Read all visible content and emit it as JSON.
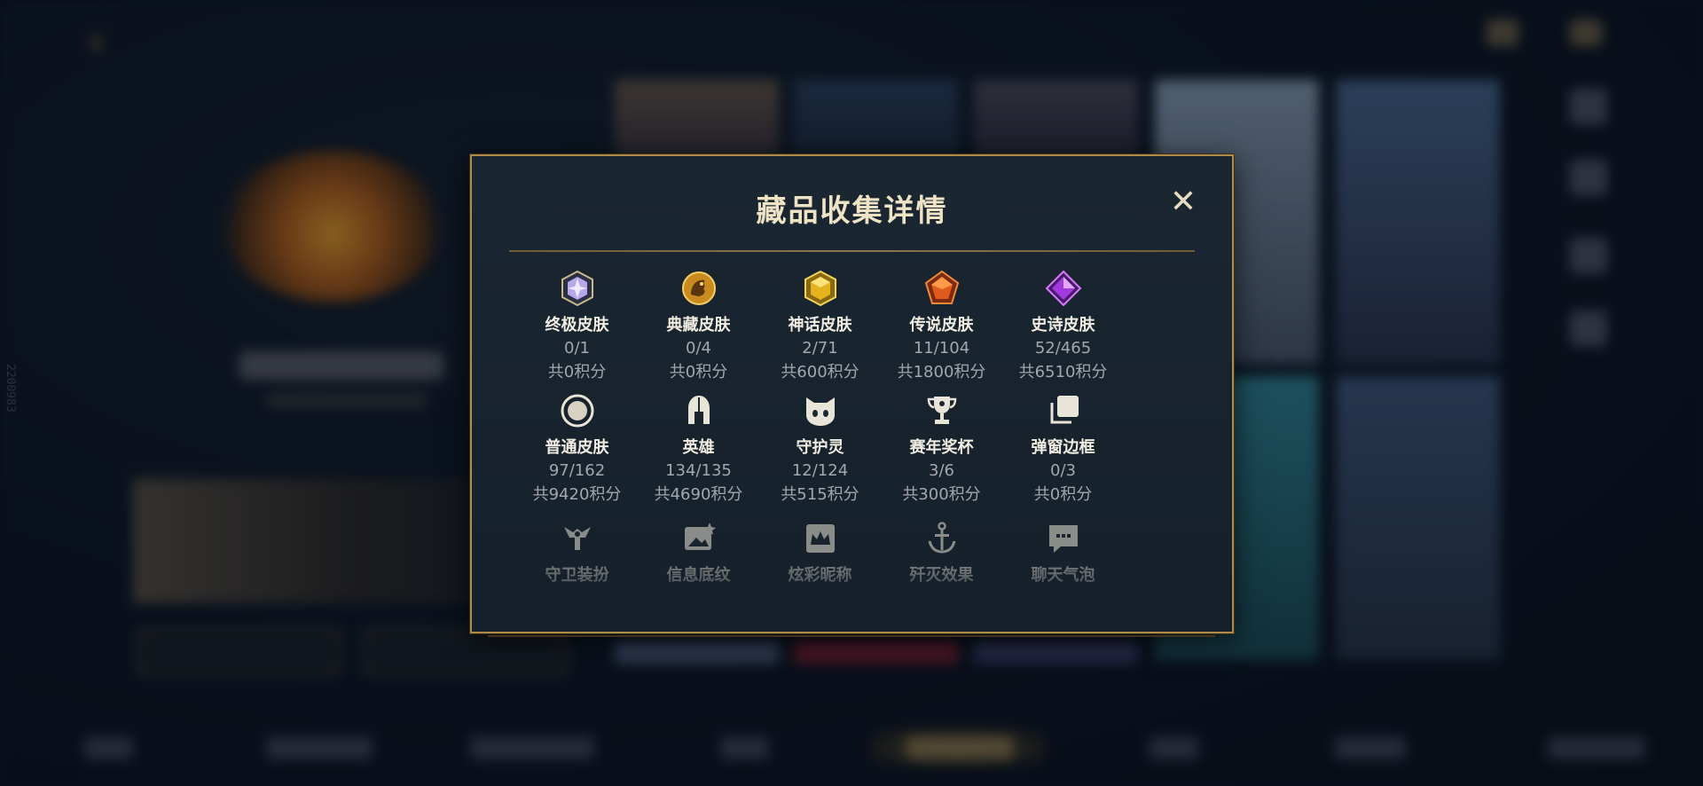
{
  "colors": {
    "accent_gold": "#b08a47",
    "modal_bg": "#16212b",
    "title_text": "#efe3c6"
  },
  "side_id": "2200983",
  "modal": {
    "title": "藏品收集详情",
    "close_icon": "close-icon",
    "rows": [
      [
        {
          "icon": "ultimate-skin-icon",
          "label": "终极皮肤",
          "count": "0/1",
          "points": "共0积分"
        },
        {
          "icon": "collection-skin-icon",
          "label": "典藏皮肤",
          "count": "0/4",
          "points": "共0积分"
        },
        {
          "icon": "myth-skin-icon",
          "label": "神话皮肤",
          "count": "2/71",
          "points": "共600积分"
        },
        {
          "icon": "legend-skin-icon",
          "label": "传说皮肤",
          "count": "11/104",
          "points": "共1800积分"
        },
        {
          "icon": "epic-skin-icon",
          "label": "史诗皮肤",
          "count": "52/465",
          "points": "共6510积分"
        }
      ],
      [
        {
          "icon": "normal-skin-icon",
          "label": "普通皮肤",
          "count": "97/162",
          "points": "共9420积分"
        },
        {
          "icon": "hero-helmet-icon",
          "label": "英雄",
          "count": "134/135",
          "points": "共4690积分"
        },
        {
          "icon": "guardian-spirit-icon",
          "label": "守护灵",
          "count": "12/124",
          "points": "共515积分"
        },
        {
          "icon": "season-trophy-icon",
          "label": "赛年奖杯",
          "count": "3/6",
          "points": "共300积分"
        },
        {
          "icon": "popup-frame-icon",
          "label": "弹窗边框",
          "count": "0/3",
          "points": "共0积分"
        }
      ],
      [
        {
          "icon": "guardian-outfit-icon",
          "label": "守卫装扮"
        },
        {
          "icon": "info-background-icon",
          "label": "信息底纹"
        },
        {
          "icon": "fancy-nickname-icon",
          "label": "炫彩昵称"
        },
        {
          "icon": "annihilation-effect-icon",
          "label": "歼灭效果"
        },
        {
          "icon": "chat-bubble-icon",
          "label": "聊天气泡"
        }
      ]
    ]
  }
}
